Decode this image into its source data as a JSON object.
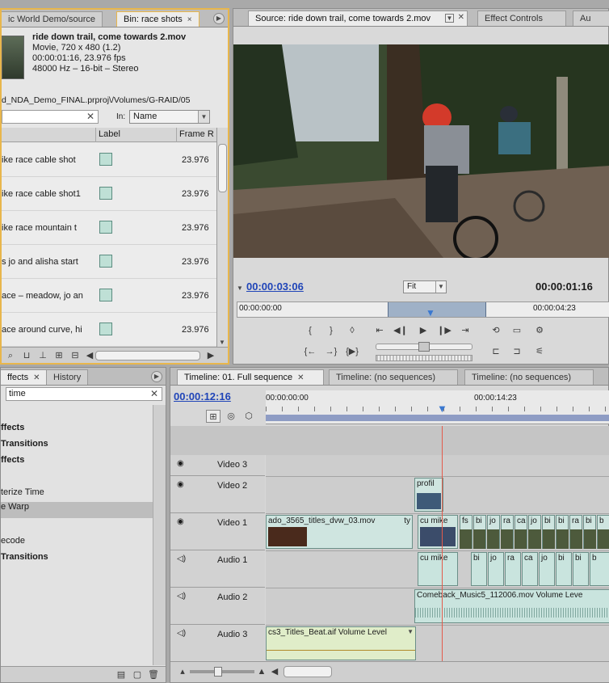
{
  "project_panel": {
    "tabs": [
      {
        "label": "ic World Demo/source"
      },
      {
        "label": "Bin: race shots",
        "close": "×"
      }
    ],
    "clip_info": {
      "name": "ride down trail, come towards 2.mov",
      "type": "Movie, 720 x 480 (1.2)",
      "duration": "00:00:01:16, 23.976 fps",
      "audio": "48000 Hz – 16-bit – Stereo"
    },
    "path": "d_NDA_Demo_FINAL.prproj\\/Volumes/G-RAID/05",
    "search_value": "",
    "in_label": "In:",
    "in_value": "Name",
    "columns": {
      "label": "Label",
      "frame": "Frame R"
    },
    "rows": [
      {
        "name": "ike race cable shot",
        "frame": "23.976"
      },
      {
        "name": "ike race cable shot1",
        "frame": "23.976"
      },
      {
        "name": "ike race mountain t",
        "frame": "23.976"
      },
      {
        "name": "s jo and alisha start",
        "frame": "23.976"
      },
      {
        "name": "ace – meadow, jo an",
        "frame": "23.976"
      },
      {
        "name": "ace around curve, hi",
        "frame": "23.976"
      }
    ]
  },
  "source_panel": {
    "tabs": [
      {
        "label": "Source: ride down trail, come towards 2.mov"
      },
      {
        "label": "Effect Controls"
      },
      {
        "label": "Au"
      }
    ],
    "timecode_current": "00:00:03:06",
    "fit_value": "Fit",
    "timecode_duration": "00:00:01:16",
    "ruler_start": "00:00:00:00",
    "ruler_end": "00:00:04:23"
  },
  "effects_panel": {
    "tabs": [
      {
        "label": "ffects"
      },
      {
        "label": "History"
      }
    ],
    "search_value": "time",
    "items": [
      {
        "label": "",
        "bold": false
      },
      {
        "label": "ffects",
        "bold": true
      },
      {
        "label": "Transitions",
        "bold": true
      },
      {
        "label": "ffects",
        "bold": true
      },
      {
        "label": "",
        "bold": false
      },
      {
        "label": "terize Time",
        "bold": false
      },
      {
        "label": "e Warp",
        "bold": false
      },
      {
        "label": "",
        "bold": false
      },
      {
        "label": "ecode",
        "bold": false
      },
      {
        "label": "Transitions",
        "bold": true
      }
    ]
  },
  "timeline_panel": {
    "tabs": [
      {
        "label": "Timeline: 01. Full sequence"
      },
      {
        "label": "Timeline: (no sequences)"
      },
      {
        "label": "Timeline: (no sequences)"
      }
    ],
    "timecode": "00:00:12:16",
    "ruler_start": "00:00:00:00",
    "ruler_mid": "00:00:14:23",
    "tracks": [
      {
        "name": "Video 3"
      },
      {
        "name": "Video 2"
      },
      {
        "name": "Video 1"
      },
      {
        "name": "Audio 1"
      },
      {
        "name": "Audio 2"
      },
      {
        "name": "Audio 3"
      }
    ],
    "clips": {
      "v2_profile": "profil",
      "v1_main": "ado_3565_titles_dvw_03.mov",
      "v1_tag": "ty",
      "v1_cu": "cu mike",
      "v1_small": [
        "fs",
        "bi",
        "jo",
        "ra",
        "ca",
        "jo",
        "bi",
        "bi",
        "ra",
        "bi",
        "b"
      ],
      "a1_cu": "cu mike",
      "a1_small": [
        "bi",
        "jo",
        "ra",
        "ca",
        "jo",
        "bi",
        "bi",
        "b"
      ],
      "a2_music": "Comeback_Music5_112006.mov Volume Leve",
      "a3_titles": "cs3_Titles_Beat.aif Volume Level"
    }
  },
  "colors": {
    "accent_border": "#e8b64c",
    "clip_fill": "#cfe5e0",
    "playhead": "#e35b4b",
    "timecode_blue": "#2045b8"
  }
}
